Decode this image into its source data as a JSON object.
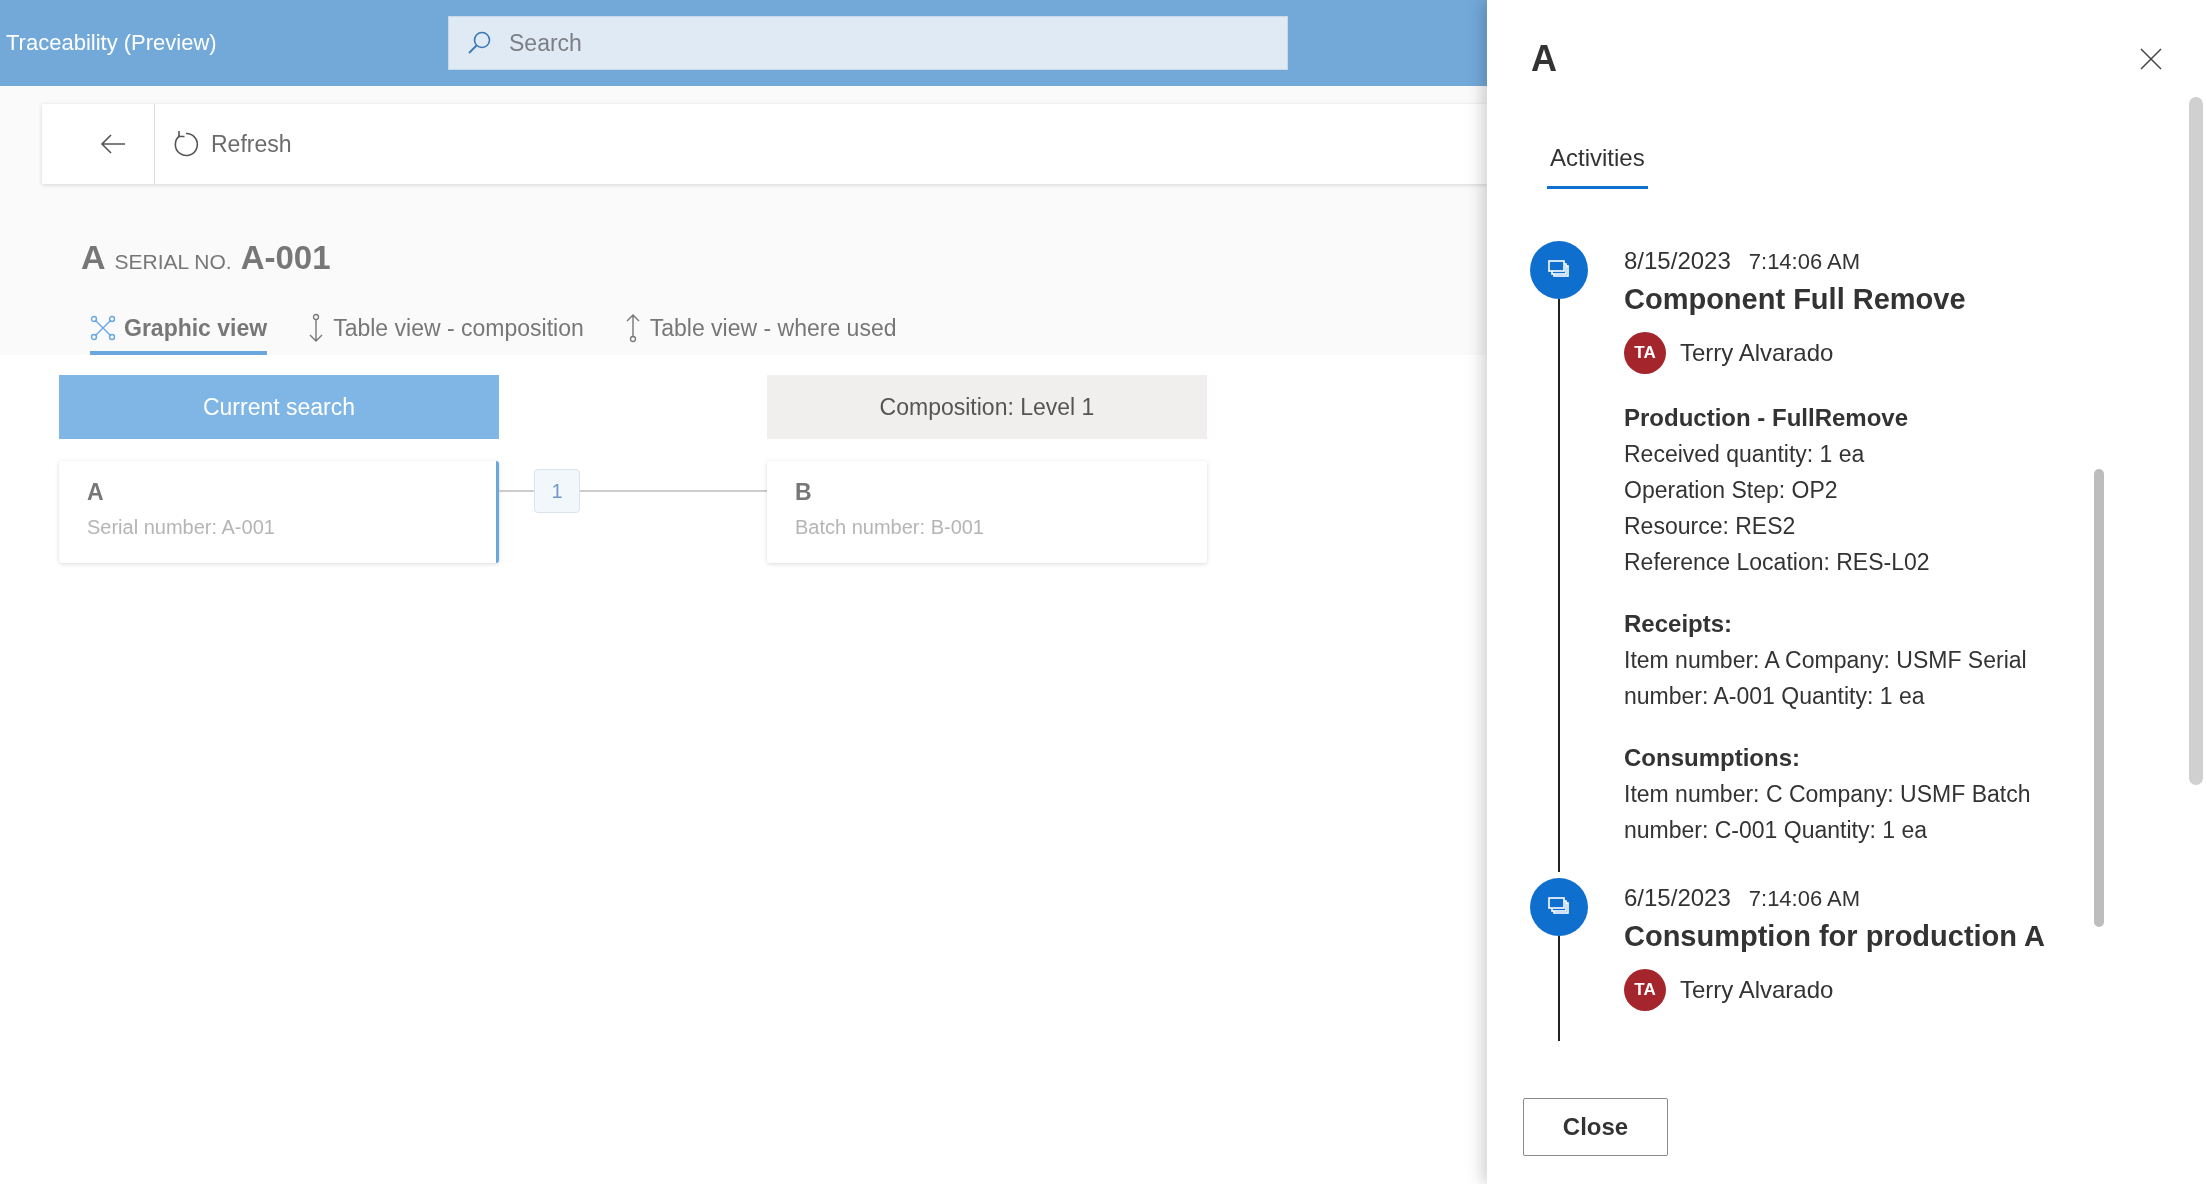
{
  "app": {
    "title": "Traceability (Preview)"
  },
  "search": {
    "placeholder": "Search"
  },
  "toolbar": {
    "refresh": "Refresh"
  },
  "record": {
    "item": "A",
    "serial_label": "SERIAL NO.",
    "serial": "A-001"
  },
  "tabs": [
    {
      "label": "Graphic view",
      "kind": "graph",
      "selected": true
    },
    {
      "label": "Table view - composition",
      "kind": "down",
      "selected": false
    },
    {
      "label": "Table view - where used",
      "kind": "up",
      "selected": false
    }
  ],
  "graph": {
    "columns": [
      {
        "label": "Current search",
        "selected": true
      },
      {
        "label": "Composition: Level 1",
        "selected": false
      }
    ],
    "nodes": [
      {
        "title": "A",
        "subtitle": "Serial number: A-001",
        "selected": true
      },
      {
        "title": "B",
        "subtitle": "Batch number: B-001",
        "selected": false
      }
    ],
    "link_label": "1"
  },
  "panel": {
    "title": "A",
    "tabs": [
      {
        "label": "Activities",
        "selected": true
      }
    ],
    "activities": [
      {
        "date": "8/15/2023",
        "time": "7:14:06 AM",
        "title": "Component Full Remove",
        "user": {
          "initials": "TA",
          "name": "Terry Alvarado"
        },
        "sections": [
          {
            "heading": "Production - FullRemove",
            "lines": [
              "Received quantity: 1 ea",
              "Operation Step: OP2",
              "Resource: RES2",
              "Reference Location: RES-L02"
            ]
          },
          {
            "heading": "Receipts:",
            "lines": [
              "Item number: A Company: USMF Serial number: A-001 Quantity: 1 ea"
            ]
          },
          {
            "heading": "Consumptions:",
            "lines": [
              "Item number: C Company: USMF Batch number: C-001 Quantity: 1 ea"
            ]
          }
        ]
      },
      {
        "date": "6/15/2023",
        "time": "7:14:06 AM",
        "title": "Consumption for production A",
        "user": {
          "initials": "TA",
          "name": "Terry Alvarado"
        }
      }
    ],
    "close_button": "Close"
  }
}
